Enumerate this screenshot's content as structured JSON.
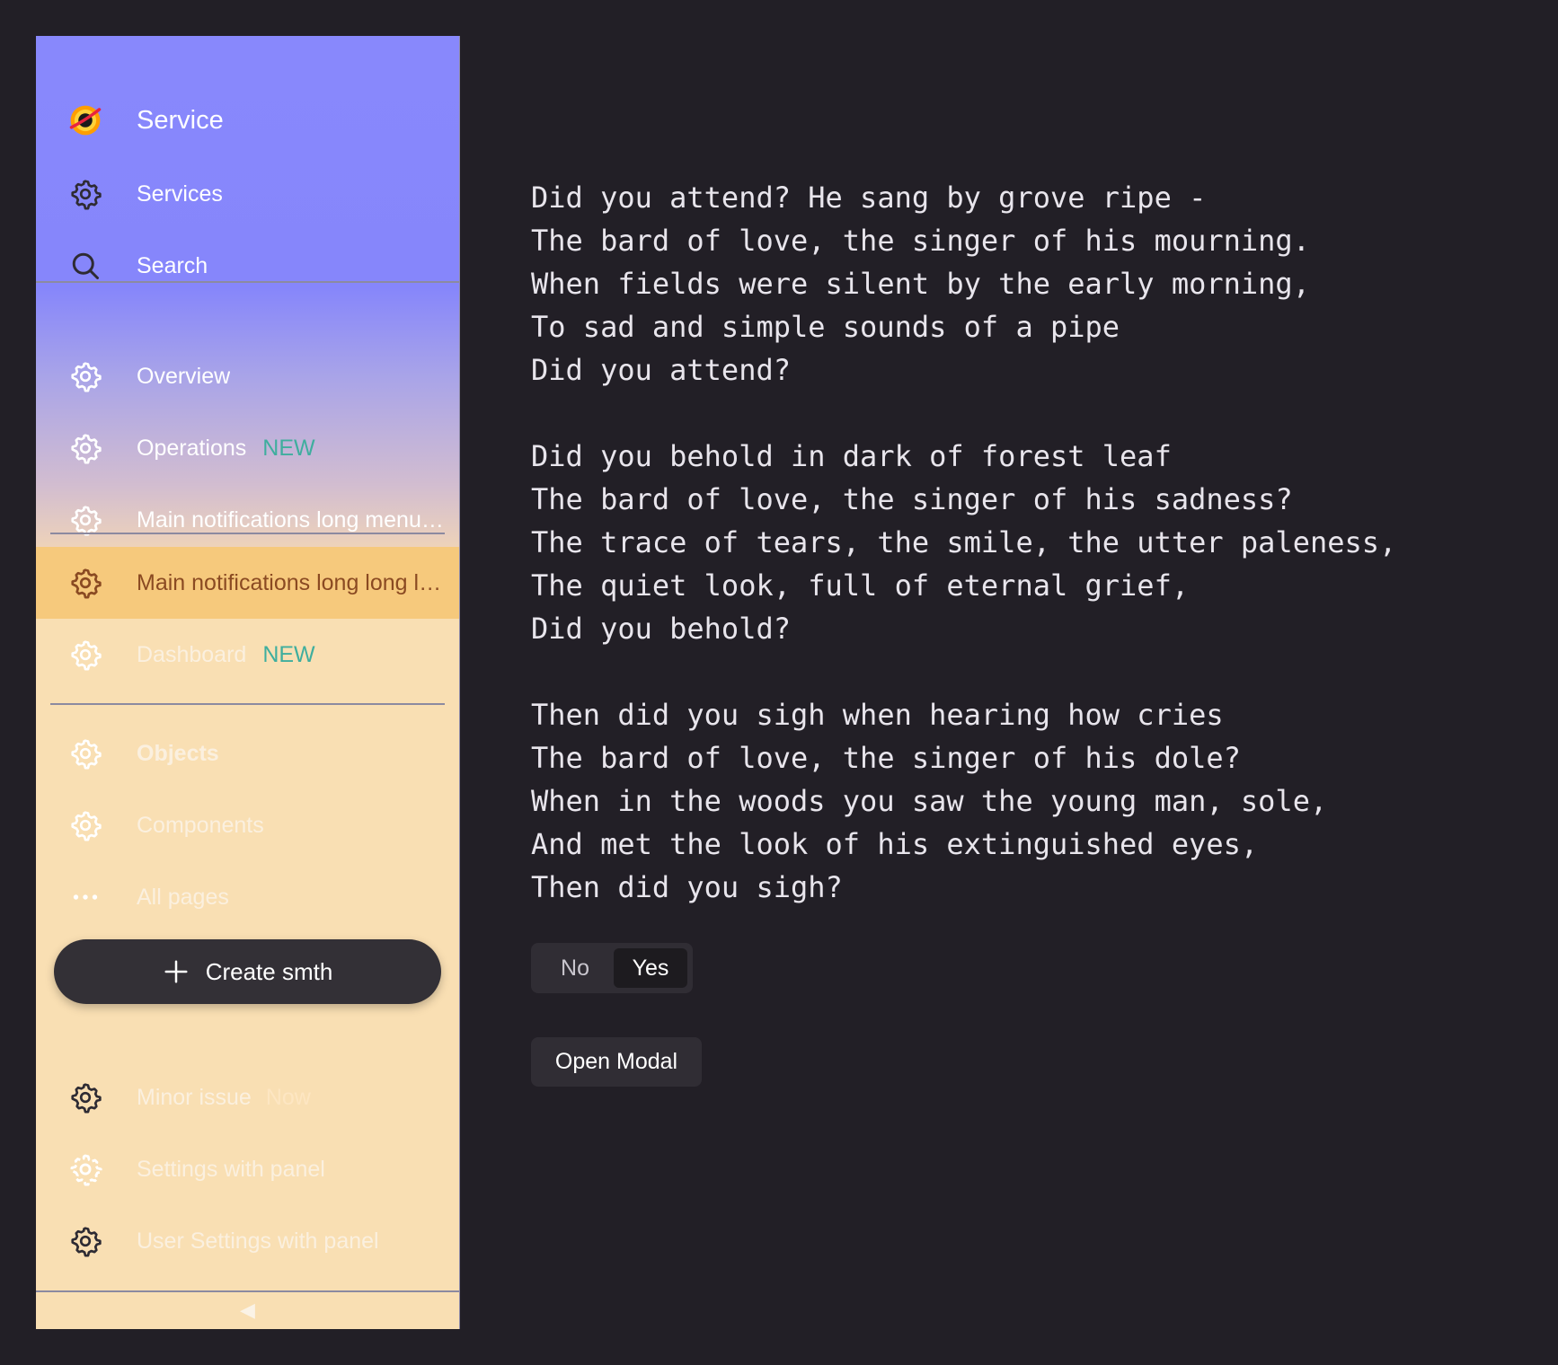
{
  "sidebar": {
    "brand": {
      "label": "Service"
    },
    "top_items": [
      {
        "label": "Services",
        "icon": "gear-icon"
      },
      {
        "label": "Search",
        "icon": "search-icon"
      }
    ],
    "items": [
      {
        "label": "Overview",
        "icon": "gear-icon"
      },
      {
        "label": "Operations",
        "tag": "NEW",
        "icon": "gear-icon"
      },
      {
        "label": "Main notifications long menu…",
        "icon": "gear-icon"
      },
      {
        "label": "Main notifications long long l…",
        "icon": "gear-icon",
        "active": true
      },
      {
        "label": "Dashboard",
        "tag": "NEW",
        "icon": "gear-icon"
      },
      {
        "label": "Objects",
        "icon": "gear-icon"
      },
      {
        "label": "Components",
        "icon": "gear-icon"
      },
      {
        "label": "All pages",
        "icon": "more-icon"
      }
    ],
    "create_button": {
      "label": "Create smth"
    },
    "bottom_items": [
      {
        "label": "Minor issue",
        "tag": "Now",
        "icon": "gear-icon"
      },
      {
        "label": "Settings with panel",
        "icon": "gear-loading-icon"
      },
      {
        "label": "User Settings with panel",
        "icon": "gear-icon"
      }
    ],
    "collapse_glyph": "◀"
  },
  "poem": {
    "stanzas": [
      [
        "Did you attend? He sang by grove ripe -",
        "The bard of love, the singer of his mourning.",
        "When fields were silent by the early morning,",
        "To sad and simple sounds of a pipe",
        "Did you attend?"
      ],
      [
        "Did you behold in dark of forest leaf",
        "The bard of love, the singer of his sadness?",
        "The trace of tears, the smile, the utter paleness,",
        "The quiet look, full of eternal grief,",
        "Did you behold?"
      ],
      [
        "Then did you sigh when hearing how cries",
        "The bard of love, the singer of his dole?",
        "When in the woods you saw the young man, sole,",
        "And met the look of his extinguished eyes,",
        "Then did you sigh?"
      ]
    ]
  },
  "segmented": {
    "options": [
      "No",
      "Yes"
    ],
    "selected": "Yes"
  },
  "modal_button": {
    "label": "Open Modal"
  },
  "colors": {
    "background": "#221f26",
    "sidebar_top": "#8888fc",
    "sidebar_bottom": "#f9dfb3",
    "active_item": "#f6c97c",
    "tag_new": "#3fae9e"
  }
}
